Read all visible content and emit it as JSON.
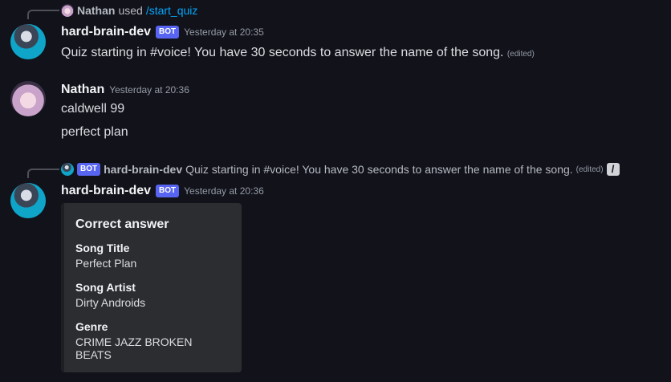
{
  "messages": [
    {
      "reply": {
        "user": "Nathan",
        "used": "used",
        "command": "/start_quiz"
      },
      "author": "hard-brain-dev",
      "badge": "BOT",
      "timestamp": "Yesterday at 20:35",
      "text": "Quiz starting in #voice! You have 30 seconds to answer the name of the song.",
      "edited": "(edited)"
    },
    {
      "author": "Nathan",
      "timestamp": "Yesterday at 20:36",
      "lines": [
        "caldwell 99",
        "perfect plan"
      ]
    },
    {
      "reply": {
        "badge": "BOT",
        "user": "hard-brain-dev",
        "text": "Quiz starting in #voice! You have 30 seconds to answer the name of the song.",
        "edited": "(edited)",
        "icon": "slash-command-icon"
      },
      "author": "hard-brain-dev",
      "badge": "BOT",
      "timestamp": "Yesterday at 20:36",
      "embed": {
        "title": "Correct answer",
        "fields": [
          {
            "name": "Song Title",
            "value": "Perfect Plan"
          },
          {
            "name": "Song Artist",
            "value": "Dirty Androids"
          },
          {
            "name": "Genre",
            "value": "CRIME JAZZ BROKEN BEATS"
          }
        ]
      }
    }
  ],
  "colors": {
    "background": "#12121b",
    "bot_badge": "#5865f2",
    "command": "#00a8fc",
    "embed": "#2b2d31"
  }
}
